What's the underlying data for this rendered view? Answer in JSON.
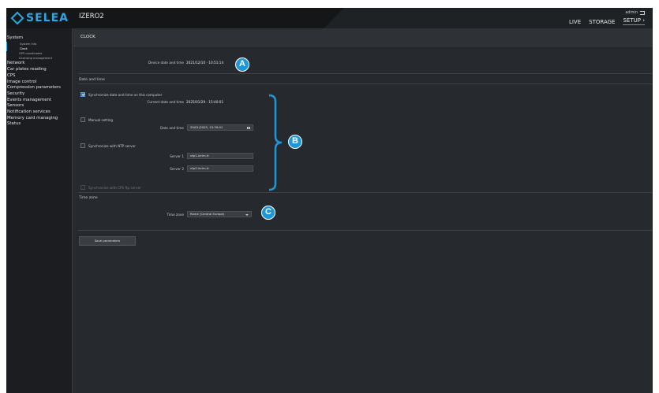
{
  "app": {
    "logo_text": "SELEA",
    "device_name": "IZERO2",
    "accent_color": "#2aa7e6"
  },
  "nav": {
    "items": [
      {
        "label": "LIVE"
      },
      {
        "label": "STORAGE"
      },
      {
        "label": "SETUP ›"
      }
    ],
    "user": "admin"
  },
  "sidebar": {
    "items": [
      {
        "label": "System"
      },
      {
        "label": "Network"
      },
      {
        "label": "Car plates reading"
      },
      {
        "label": "CPS"
      },
      {
        "label": "Image control"
      },
      {
        "label": "Compression parameters"
      },
      {
        "label": "Security"
      },
      {
        "label": "Events management"
      },
      {
        "label": "Sensors"
      },
      {
        "label": "Notification services"
      },
      {
        "label": "Memory card managing"
      },
      {
        "label": "Status"
      }
    ],
    "system_subitems": [
      {
        "label": "System info"
      },
      {
        "label": "Clock"
      },
      {
        "label": "GPS coordinates"
      },
      {
        "label": "Licensing management"
      }
    ]
  },
  "page": {
    "title": "CLOCK",
    "device_datetime_label": "Device date and time",
    "device_datetime_value": "2021/12/10 - 10:51:14",
    "date_time_section": "Date and time",
    "sync_computer_label": "Synchronize date and time on this computer",
    "current_datetime_label": "Current date and time",
    "current_datetime_value": "2025/01/29 - 15:40:01",
    "manual_setting_label": "Manual setting",
    "date_time_label": "Date and time",
    "date_time_value": "29/01/2025, 15:39:01",
    "ntp_label": "Synchronize with NTP server",
    "server1_label": "Server 1",
    "server1_value": "ntp1.inrim.it",
    "server2_label": "Server 2",
    "server2_value": "ntp2.inrim.it",
    "cps_ftp_label": "Synchronize with CPS ftp server",
    "time_zone_section": "Time zone",
    "time_zone_label": "Time zone",
    "time_zone_value": "Rome (Central Europe)",
    "save_button": "Save parameters"
  },
  "callouts": {
    "a": "A",
    "b": "B",
    "c": "C"
  }
}
